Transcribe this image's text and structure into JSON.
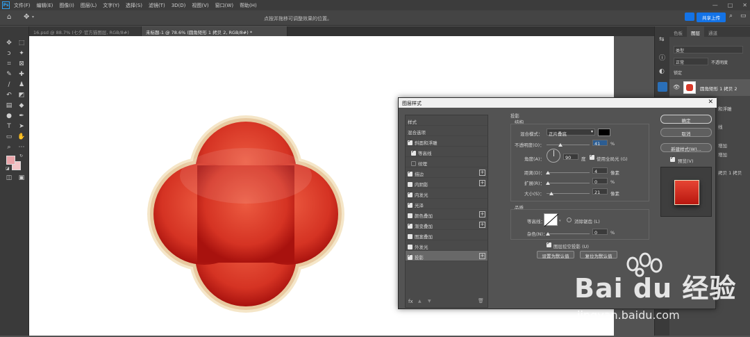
{
  "menubar": {
    "logo": "Ps",
    "items": [
      "文件(F)",
      "编辑(E)",
      "图像(I)",
      "图层(L)",
      "文字(Y)",
      "选择(S)",
      "滤镜(T)",
      "3D(D)",
      "视图(V)",
      "窗口(W)",
      "帮助(H)"
    ],
    "window_controls": [
      "—",
      "□",
      "✕"
    ]
  },
  "options": {
    "hint": "点按并拖移可调整效果的位置。",
    "cloud_label": "共享上传"
  },
  "tabs": [
    {
      "label": "16.psd @ 88.7% (七夕·官方猫图层, RGB/8#)",
      "active": false
    },
    {
      "label": "未标题-1 @ 78.6% (圆角矩形 1 拷贝 2, RGB/8#) *",
      "active": true
    }
  ],
  "tools_icons": [
    "move-icon",
    "marquee-icon",
    "lasso-icon",
    "magic-wand-icon",
    "crop-icon",
    "frame-icon",
    "eyedropper-icon",
    "healing-icon",
    "brush-icon",
    "stamp-icon",
    "history-brush-icon",
    "eraser-icon",
    "gradient-icon",
    "blur-icon",
    "dodge-icon",
    "pen-icon",
    "type-icon",
    "path-select-icon",
    "shape-icon",
    "hand-icon",
    "zoom-icon",
    "more-icon"
  ],
  "colors": {
    "foreground": "#e9a3a8",
    "background": "#f2c4c6",
    "shape_main": "#d93a2b",
    "shape_border": "#f5e6c8",
    "accent_blue": "#1473e6"
  },
  "layers_panel": {
    "tabs": [
      "色板",
      "图层",
      "通道"
    ],
    "active_tab": "图层",
    "search_label": "类型",
    "mode_label": "正常",
    "opacity_label": "不透明度",
    "opacity_value": "100%",
    "lock_label": "锁定",
    "fill_label": "填充",
    "fill_value": "100%",
    "layer_name": "圆角矩形 1 拷贝 2",
    "fx_items": [
      "和浮雕",
      "线",
      "增加",
      "增加",
      "",
      "拷贝 1 拷贝"
    ]
  },
  "dialog": {
    "title": "图层样式",
    "close": "✕",
    "styles_header": "样式",
    "blend_options": "混合选项",
    "styles": [
      {
        "label": "斜面和浮雕",
        "checked": true,
        "indent": false,
        "plus": false
      },
      {
        "label": "等高线",
        "checked": true,
        "indent": true,
        "plus": false
      },
      {
        "label": "纹理",
        "checked": false,
        "indent": true,
        "plus": false
      },
      {
        "label": "描边",
        "checked": true,
        "indent": false,
        "plus": true
      },
      {
        "label": "内阴影",
        "checked": false,
        "indent": false,
        "plus": true
      },
      {
        "label": "内发光",
        "checked": true,
        "indent": false,
        "plus": false
      },
      {
        "label": "光泽",
        "checked": true,
        "indent": false,
        "plus": false
      },
      {
        "label": "颜色叠加",
        "checked": false,
        "indent": false,
        "plus": true
      },
      {
        "label": "渐变叠加",
        "checked": true,
        "indent": false,
        "plus": true
      },
      {
        "label": "图案叠加",
        "checked": false,
        "indent": false,
        "plus": false
      },
      {
        "label": "外发光",
        "checked": false,
        "indent": false,
        "plus": false
      },
      {
        "label": "投影",
        "checked": true,
        "indent": false,
        "plus": true,
        "selected": true
      }
    ],
    "bottom_icons": [
      "fx",
      "▲",
      "▼",
      "🗑"
    ],
    "section_title": "投影",
    "structure_title": "结构",
    "blend_mode_label": "混合模式：",
    "blend_mode_value": "正片叠底",
    "opacity_label": "不透明度(O)：",
    "opacity_value": "41",
    "opacity_unit": "%",
    "angle_label": "角度(A)：",
    "angle_value": "90",
    "angle_unit": "度",
    "global_light_label": "使用全局光 (G)",
    "distance_label": "距离(D)：",
    "distance_value": "4",
    "distance_unit": "像素",
    "spread_label": "扩展(R)：",
    "spread_value": "0",
    "spread_unit": "%",
    "size_label": "大小(S)：",
    "size_value": "21",
    "size_unit": "像素",
    "quality_title": "品质",
    "contour_label": "等高线：",
    "antialias_label": "消除锯齿 (L)",
    "noise_label": "杂色(N)：",
    "noise_value": "0",
    "noise_unit": "%",
    "knockout_label": "图层挖空投影 (U)",
    "set_default": "设置为默认值",
    "reset_default": "复位为默认值",
    "ok": "确定",
    "cancel": "取消",
    "new_style": "新建样式(W)...",
    "preview_label": "预览(V)",
    "shadow_color": "#000000"
  },
  "watermark": {
    "brand": "Bai du 经验",
    "url": "jingyan.baidu.com"
  }
}
